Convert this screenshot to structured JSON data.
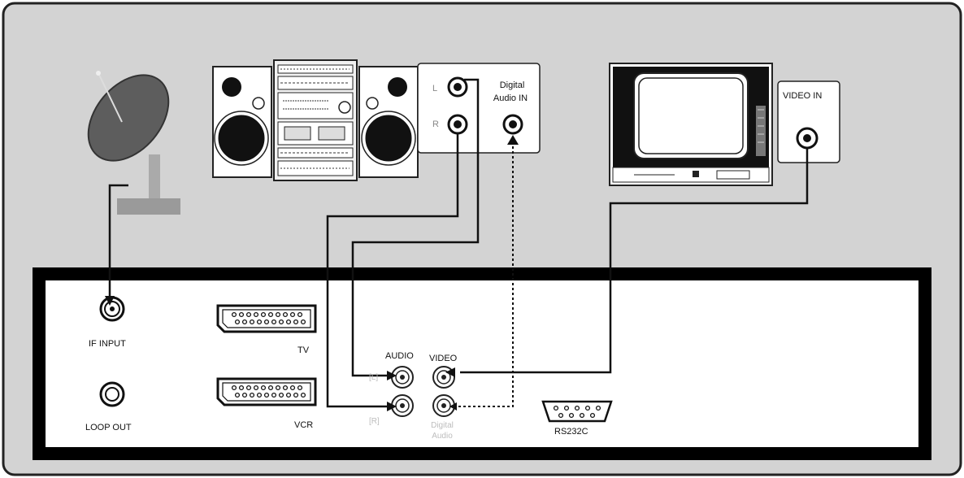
{
  "diagram": {
    "stereo_panel": {
      "left_marks": [
        "L",
        "R"
      ],
      "digital_audio_in": [
        "Digital",
        "Audio IN"
      ]
    },
    "tv_panel": {
      "video_in": "VIDEO IN"
    },
    "receiver_panel": {
      "if_input": "IF INPUT",
      "loop_out": "LOOP OUT",
      "tv": "TV",
      "vcr": "VCR",
      "audio": "AUDIO",
      "video": "VIDEO",
      "audio_marks": [
        "[L]",
        "[R]"
      ],
      "digital_audio": [
        "Digital",
        "Audio"
      ],
      "rs232c": "RS232C"
    }
  }
}
